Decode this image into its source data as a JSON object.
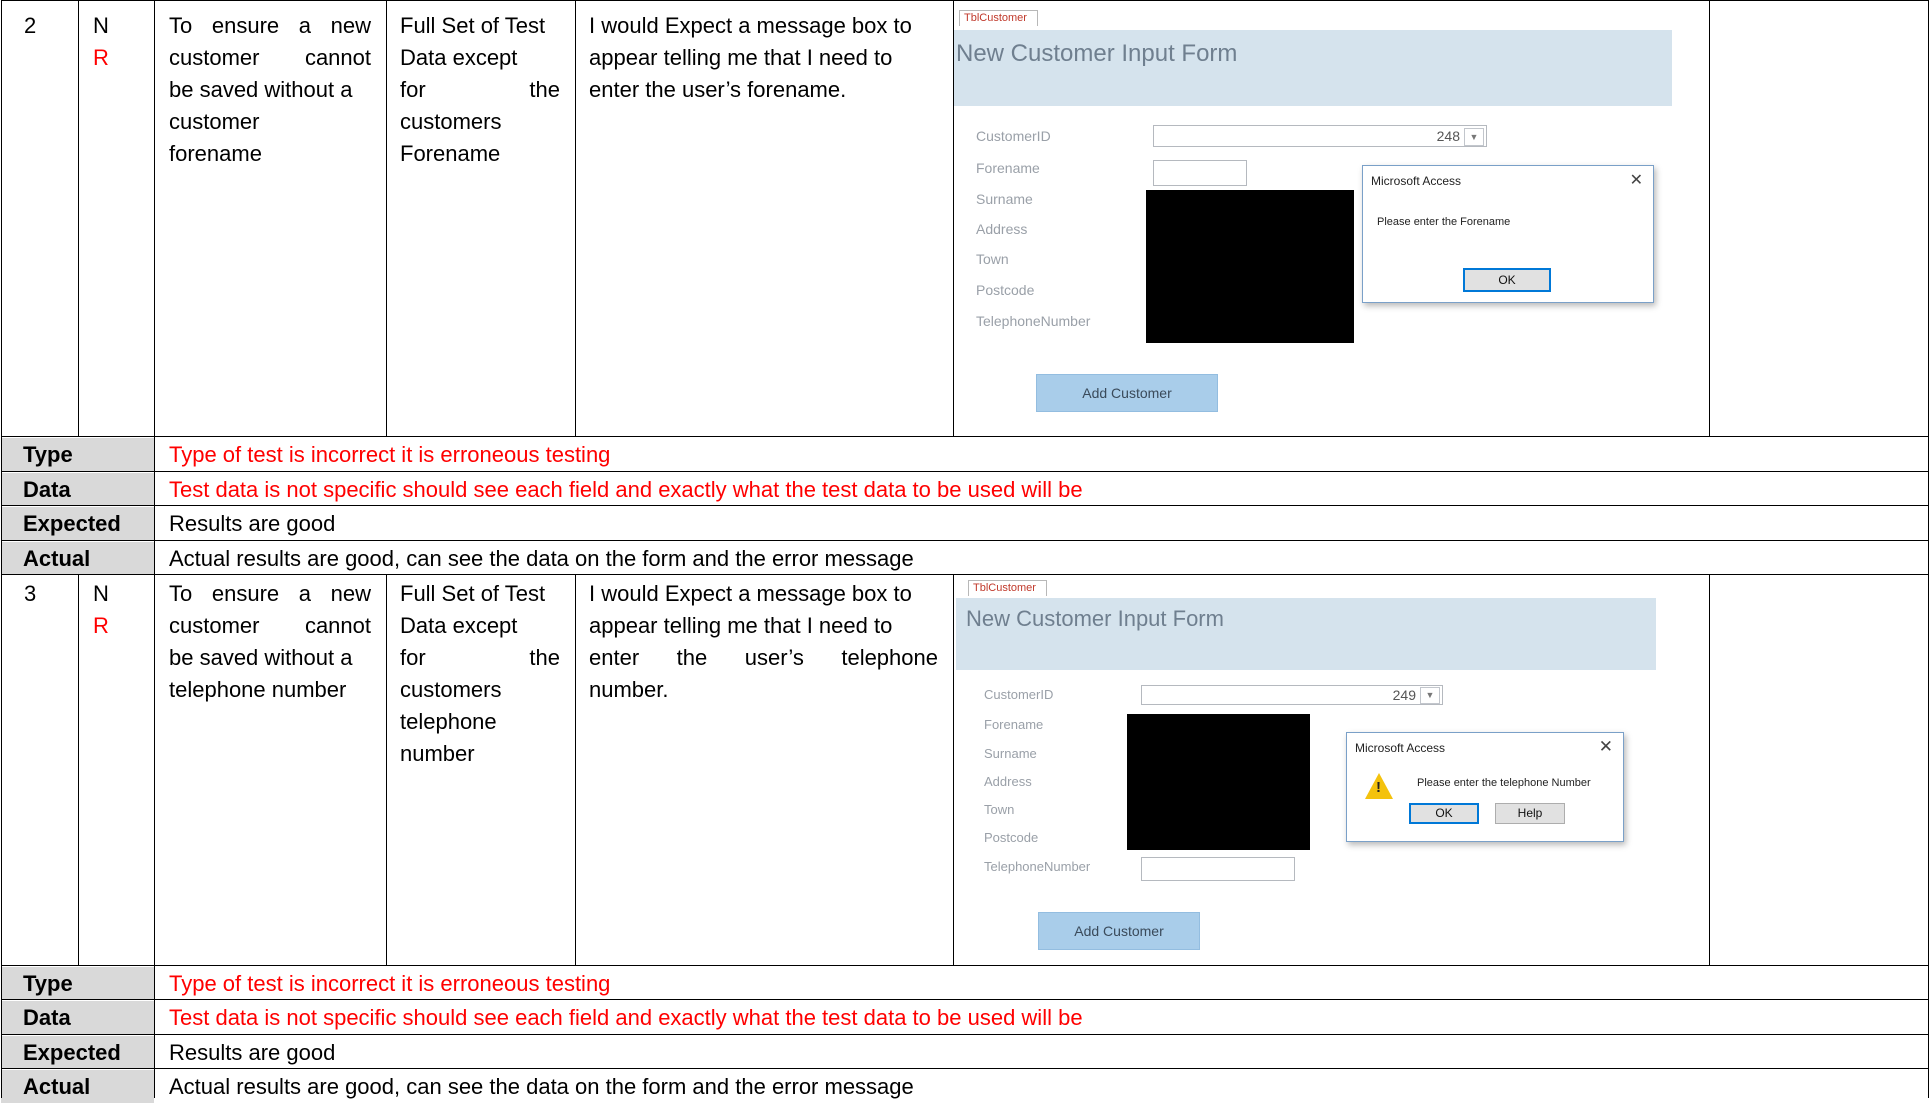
{
  "rows": [
    {
      "number": "2",
      "code_n": "N",
      "code_r": "R",
      "purpose_lines": [
        "To ensure a new",
        "customer cannot",
        "be saved without a",
        "customer",
        "forename"
      ],
      "test_data_lines": [
        "Full Set of Test",
        "Data except",
        "for the",
        "customers",
        "Forename"
      ],
      "expected_lines": [
        "I would Expect a message box to",
        "appear telling me that I need to",
        "enter the user’s forename."
      ],
      "screenshot": {
        "tab": "TblCustomer",
        "form_title": "New Customer Input Form",
        "labels": [
          "CustomerID",
          "Forename",
          "Surname",
          "Address",
          "Town",
          "Postcode",
          "TelephoneNumber"
        ],
        "customer_id": "248",
        "dialog": {
          "title": "Microsoft Access",
          "close": "✕",
          "message": "Please enter the Forename",
          "ok": "OK"
        },
        "add_button": "Add Customer"
      },
      "feedback": {
        "type_label": "Type",
        "type_text": "Type of test is incorrect it is erroneous testing",
        "data_label": "Data",
        "data_text": "Test data is not specific should see each field and exactly what the test data to be used will be",
        "expected_label": "Expected",
        "expected_text": "Results are good",
        "actual_label": "Actual",
        "actual_text": "Actual results are good, can see the data on the form and the error message"
      }
    },
    {
      "number": "3",
      "code_n": "N",
      "code_r": "R",
      "purpose_lines": [
        "To ensure a new",
        "customer cannot",
        "be saved without a",
        "telephone number"
      ],
      "test_data_lines": [
        "Full Set of Test",
        "Data except",
        "for the",
        "customers",
        "telephone",
        "number"
      ],
      "expected_lines": [
        "I would Expect a message box to",
        "appear telling me that I need to",
        "enter the user’s telephone",
        "number."
      ],
      "screenshot": {
        "tab": "TblCustomer",
        "form_title": "New Customer Input Form",
        "labels": [
          "CustomerID",
          "Forename",
          "Surname",
          "Address",
          "Town",
          "Postcode",
          "TelephoneNumber"
        ],
        "customer_id": "249",
        "dialog": {
          "title": "Microsoft Access",
          "close": "✕",
          "message": "Please enter the telephone Number",
          "ok": "OK",
          "help": "Help",
          "warn_glyph": "!"
        },
        "add_button": "Add Customer"
      },
      "feedback": {
        "type_label": "Type",
        "type_text": "Type of test is incorrect it is erroneous testing",
        "data_label": "Data",
        "data_text": "Test data is not specific should see each field and exactly what the test data to be used will be",
        "expected_label": "Expected",
        "expected_text": "Results are good",
        "actual_label": "Actual",
        "actual_text": "Actual results are good, can see the data on the form and the error message"
      }
    }
  ],
  "colors": {
    "comment_red": "#ff0000",
    "label_gray": "#d9d9d9",
    "form_band": "#d5e3ed",
    "add_button": "#a9cdea"
  }
}
